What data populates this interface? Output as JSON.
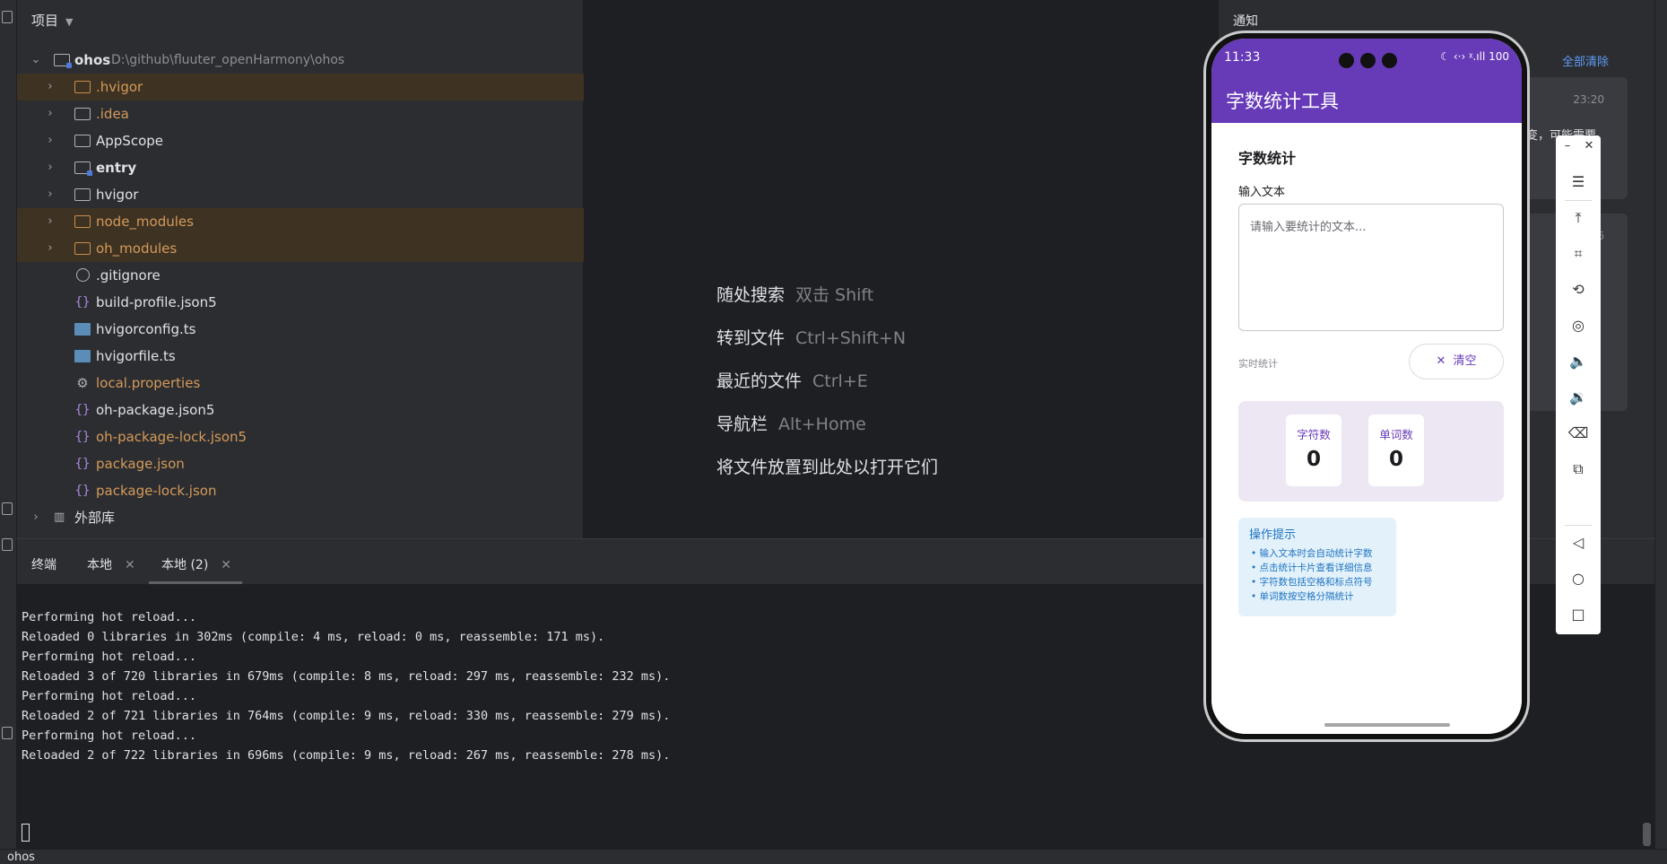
{
  "project_panel": {
    "header": "项目",
    "tree": [
      {
        "label": "ohos",
        "path": "D:\\github\\fluuter_openHarmony\\ohos",
        "kind": "module-root",
        "expanded": true
      },
      {
        "label": ".hvigor",
        "kind": "folder",
        "excluded": true
      },
      {
        "label": ".idea",
        "kind": "folder",
        "excluded": false
      },
      {
        "label": "AppScope",
        "kind": "folder"
      },
      {
        "label": "entry",
        "kind": "module"
      },
      {
        "label": "hvigor",
        "kind": "folder"
      },
      {
        "label": "node_modules",
        "kind": "folder",
        "excluded": true
      },
      {
        "label": "oh_modules",
        "kind": "folder",
        "excluded": true
      },
      {
        "label": ".gitignore",
        "kind": "ignore-file"
      },
      {
        "label": "build-profile.json5",
        "kind": "json"
      },
      {
        "label": "hvigorconfig.ts",
        "kind": "ts"
      },
      {
        "label": "hvigorfile.ts",
        "kind": "ts"
      },
      {
        "label": "local.properties",
        "kind": "properties"
      },
      {
        "label": "oh-package.json5",
        "kind": "json"
      },
      {
        "label": "oh-package-lock.json5",
        "kind": "json"
      },
      {
        "label": "package.json",
        "kind": "json"
      },
      {
        "label": "package-lock.json",
        "kind": "json"
      },
      {
        "label": "外部库",
        "kind": "library"
      }
    ]
  },
  "editor_hints": [
    {
      "action": "随处搜索",
      "shortcut": "双击 Shift"
    },
    {
      "action": "转到文件",
      "shortcut": "Ctrl+Shift+N"
    },
    {
      "action": "最近的文件",
      "shortcut": "Ctrl+E"
    },
    {
      "action": "导航栏",
      "shortcut": "Alt+Home"
    },
    {
      "action": "将文件放置到此处以打开它们",
      "shortcut": ""
    }
  ],
  "notifications": {
    "title": "通知",
    "clear_all": "全部清除",
    "time": "23:20",
    "snippet": "改变，可能需要",
    "time2": "16"
  },
  "terminal": {
    "title": "终端",
    "tabs": [
      "本地",
      "本地 (2)"
    ],
    "active_tab": "本地 (2)",
    "lines": [
      "Performing hot reload...",
      "Reloaded 0 libraries in 302ms (compile: 4 ms, reload: 0 ms, reassemble: 171 ms).",
      "",
      "Performing hot reload...",
      "Reloaded 3 of 720 libraries in 679ms (compile: 8 ms, reload: 297 ms, reassemble: 232 ms).",
      "",
      "Performing hot reload...",
      "Reloaded 2 of 721 libraries in 764ms (compile: 9 ms, reload: 330 ms, reassemble: 279 ms).",
      "",
      "Performing hot reload...",
      "Reloaded 2 of 722 libraries in 696ms (compile: 9 ms, reload: 267 ms, reassemble: 278 ms)."
    ]
  },
  "status_bar": {
    "text": "ohos"
  },
  "phone": {
    "status_time": "11:33",
    "status_icons": "☾ ‹·› ᵡ.ıll 100",
    "app_title": "字数统计工具",
    "section_title": "字数统计",
    "input_label": "输入文本",
    "input_placeholder": "请输入要统计的文本...",
    "live_label": "实时统计",
    "clear_label": "清空",
    "stats": [
      {
        "label": "字符数",
        "value": "0"
      },
      {
        "label": "单词数",
        "value": "0"
      }
    ],
    "tips_title": "操作提示",
    "tips": [
      "• 输入文本时会自动统计字数",
      "• 点击统计卡片查看详细信息",
      "• 字符数包括空格和标点符号",
      "• 单词数按空格分隔统计"
    ]
  },
  "colors": {
    "accent": "#673ab7",
    "ide_bg": "#2b2d30",
    "editor_bg": "#1e1f22",
    "excluded_folder": "#d59a5a",
    "tips_blue": "#1e74c2"
  }
}
